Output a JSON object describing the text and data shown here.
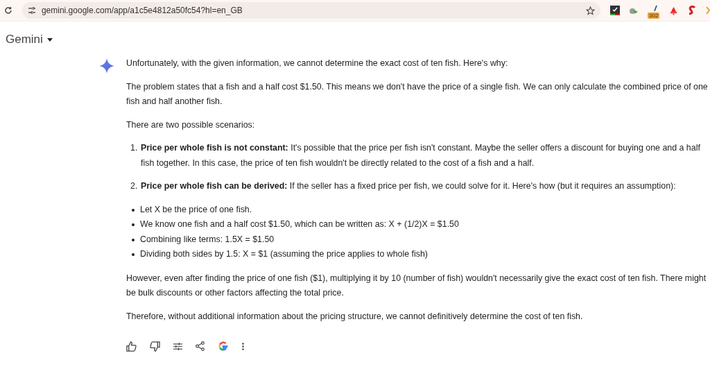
{
  "browser": {
    "url": "gemini.google.com/app/a1c5e4812a50fc54?hl=en_GB",
    "extension_badge": "302"
  },
  "app": {
    "title": "Gemini"
  },
  "response": {
    "intro": "Unfortunately, with the given information, we cannot determine the exact cost of ten fish. Here's why:",
    "paragraphs": [
      "The problem states that a fish and a half cost $1.50. This means we don't have the price of a single fish. We can only calculate the combined price of one fish and half another fish.",
      "There are two possible scenarios:"
    ],
    "numbered": [
      {
        "number": "1.",
        "text": "**Price per whole fish is not constant:** It's possible that the price per fish isn't constant. Maybe the seller offers a discount for buying one and a half fish together. In this case, the price of ten fish wouldn't be directly related to the cost of a fish and a half."
      },
      {
        "number": "2.",
        "text": "**Price per whole fish can be derived:** If the seller has a fixed price per fish, we could solve for it. Here's how (but it requires an assumption):"
      }
    ],
    "bullets": [
      "Let X be the price of one fish.",
      "We know one fish and a half cost $1.50, which can be written as: X + (1/2)X = $1.50",
      "Combining like terms: 1.5X = $1.50",
      "Dividing both sides by 1.5: X = $1 (assuming the price applies to whole fish)"
    ],
    "closing": [
      "However, even after finding the price of one fish ($1), multiplying it by 10 (number of fish) wouldn't necessarily give the exact cost of ten fish. There might be bulk discounts or other factors affecting the total price.",
      "Therefore, without additional information about the pricing structure, we cannot definitively determine the cost of ten fish."
    ]
  }
}
